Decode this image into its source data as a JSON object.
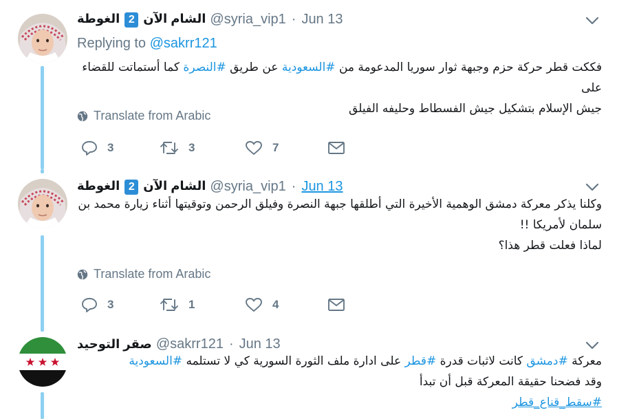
{
  "tweets": [
    {
      "display_name": "الشام الآن",
      "badge": "2",
      "name_suffix": "الغوطة",
      "handle": "@syria_vip1",
      "sep": "·",
      "date": "Jun 13",
      "replying_prefix": "Replying to",
      "replying_handle": "@sakrr121",
      "line1_a": "فككت قطر حركة حزم وجبهة ثوار سوريا المدعومة من ",
      "line1_tag1": "#السعودية",
      "line1_b": " عن طريق ",
      "line1_tag2": "#النصرة",
      "line1_c": " كما أستماتت للقضاء على",
      "line2": "جيش الإسلام بتشكيل جيش الفسطاط وحليفه الفيلق",
      "translate": "Translate from Arabic",
      "reply_count": "3",
      "retweet_count": "3",
      "like_count": "7"
    },
    {
      "display_name": "الشام الآن",
      "badge": "2",
      "name_suffix": "الغوطة",
      "handle": "@syria_vip1",
      "sep": "·",
      "date": "Jun 13",
      "line1": "وكلنا يذكر معركة دمشق الوهمية الأخيرة التي أطلقها جبهة النصرة وفيلق الرحمن وتوقيتها أثناء زيارة محمد بن",
      "line2": "سلمان لأمريكا !!",
      "line3": "لماذا فعلت قطر هذا؟",
      "translate": "Translate from Arabic",
      "reply_count": "3",
      "retweet_count": "1",
      "like_count": "4"
    },
    {
      "display_name": "صقر التوحيد",
      "handle": "@sakrr121",
      "sep": "·",
      "date": "Jun 13",
      "line1_a": "معركة ",
      "line1_tag1": "#دمشق",
      "line1_b": " كانت لاثبات قدرة ",
      "line1_tag2": "#قطر",
      "line1_c": " على ادارة ملف الثورة السورية كي لا تستلمه ",
      "line1_tag3": "#السعودية",
      "line2": "وقد فضحنا حقيقة المعركة قبل أن تبدأ",
      "line3_tag": "#سقط_قناع_قطر"
    }
  ],
  "colors": {
    "link": "#1b95e0",
    "muted": "#657786",
    "thread_line": "#8ed0f1",
    "badge": "#2d8dd6"
  },
  "icons": [
    "caret-down-icon",
    "globe-icon",
    "reply-icon",
    "retweet-icon",
    "heart-icon",
    "mail-icon"
  ]
}
